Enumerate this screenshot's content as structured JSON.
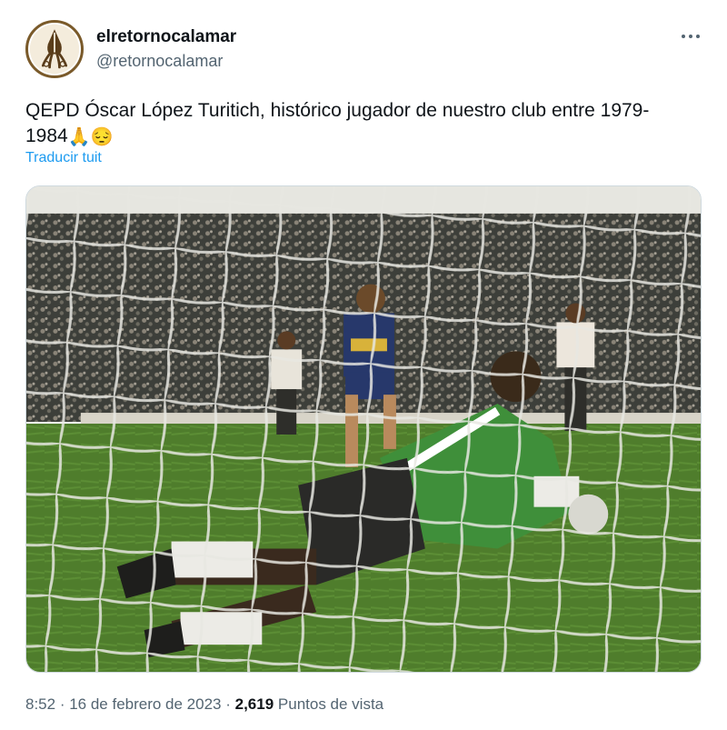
{
  "author": {
    "display_name": "elretornocalamar",
    "handle": "@retornocalamar"
  },
  "tweet": {
    "text_line1": "QEPD Óscar López Turitich, histórico jugador de nuestro club entre 1979-",
    "text_line2": "1984",
    "emojis": [
      "🙏",
      "😔"
    ],
    "translate_label": "Traducir tuit"
  },
  "meta": {
    "time": "8:52",
    "separator1": " · ",
    "date": "16 de febrero de 2023",
    "separator2": " · ",
    "views_count": "2,619",
    "views_label": " Puntos de vista"
  },
  "icons": {
    "more": "more-horizontal-icon",
    "avatar": "squid-logo-icon"
  },
  "colors": {
    "link": "#1d9bf0",
    "secondary_text": "#536471",
    "primary_text": "#0f1419"
  }
}
